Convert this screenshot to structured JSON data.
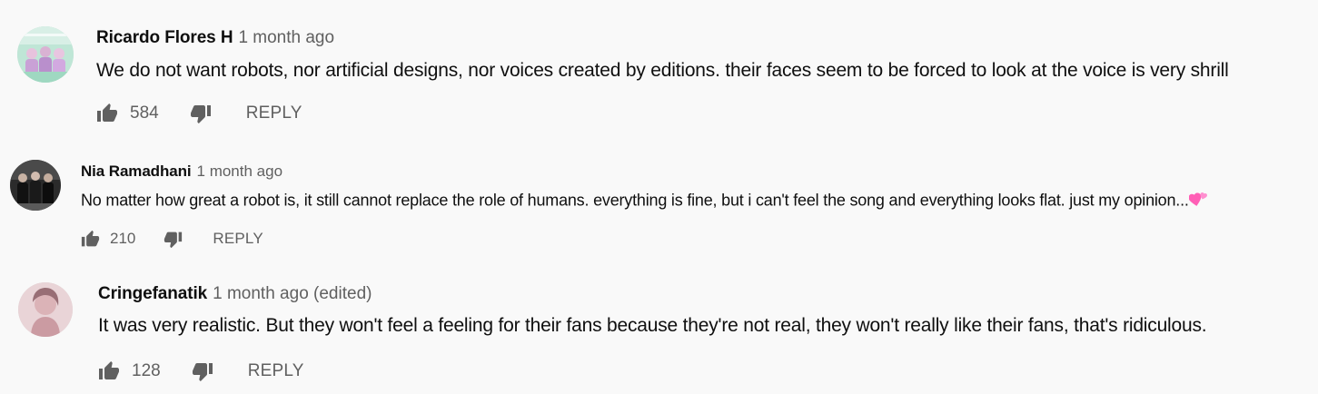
{
  "comments": [
    {
      "author": "Ricardo Flores H",
      "time": "1 month ago",
      "text": "We do not want robots, nor artificial designs, nor voices created by editions. their faces seem to be forced to look at the voice is very shrill",
      "likes": "584",
      "reply_label": "REPLY",
      "emoji": ""
    },
    {
      "author": "Nia Ramadhani",
      "time": "1 month ago",
      "text": "No matter how great a robot is, it still cannot replace the role of humans. everything is fine, but i can't feel the song and everything looks flat. just my opinion...",
      "likes": "210",
      "reply_label": "REPLY",
      "emoji": "two-hearts"
    },
    {
      "author": "Cringefanatik",
      "time": "1 month ago (edited)",
      "text": "It was very realistic. But they won't feel a feeling for their fans because they're not real, they won't really like their fans, that's ridiculous.",
      "likes": "128",
      "reply_label": "REPLY",
      "emoji": ""
    }
  ],
  "icons": {
    "like": "thumb-up-icon",
    "dislike": "thumb-down-icon",
    "emoji": "two-hearts-emoji"
  },
  "colors": {
    "background": "#f9f9f9",
    "text_primary": "#0f0f0f",
    "text_secondary": "#606060",
    "icon": "#606060",
    "heart_pink": "#ff5fb6"
  }
}
